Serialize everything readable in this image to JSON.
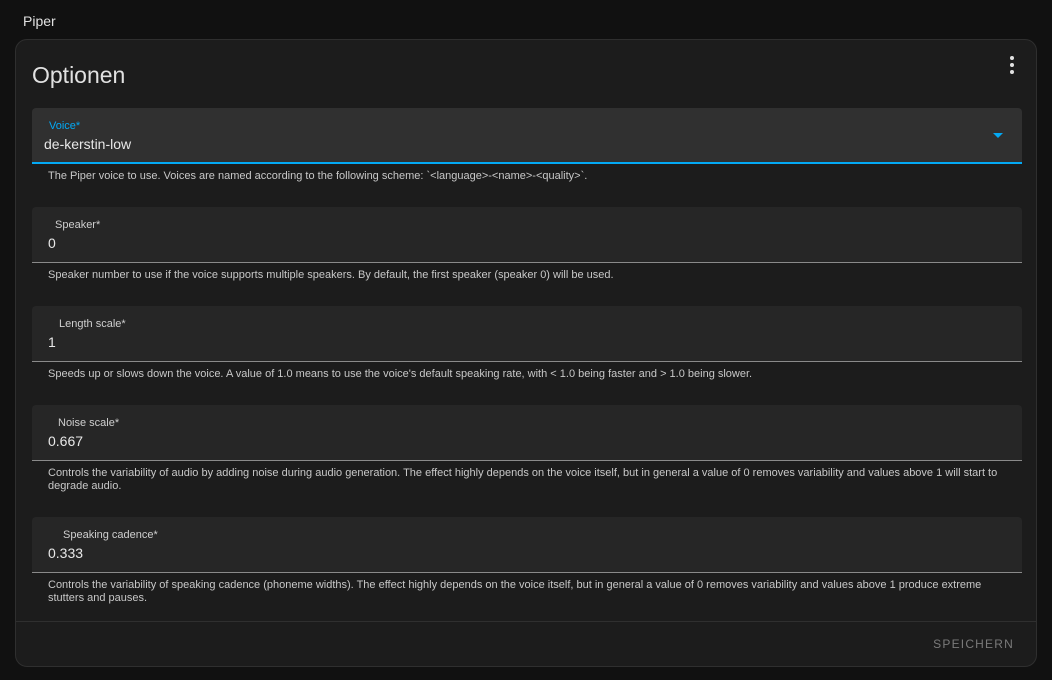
{
  "page": {
    "header": "Piper"
  },
  "card": {
    "title": "Optionen",
    "save_label": "SPEICHERN"
  },
  "fields": {
    "voice": {
      "label": "Voice*",
      "value": "de-kerstin-low",
      "helper": "The Piper voice to use. Voices are named according to the following scheme: `<language>-<name>-<quality>`."
    },
    "speaker": {
      "label": "Speaker*",
      "value": "0",
      "helper": "Speaker number to use if the voice supports multiple speakers. By default, the first speaker (speaker 0) will be used."
    },
    "length_scale": {
      "label": "Length scale*",
      "value": "1",
      "helper": "Speeds up or slows down the voice. A value of 1.0 means to use the voice's default speaking rate, with < 1.0 being faster and > 1.0 being slower."
    },
    "noise_scale": {
      "label": "Noise scale*",
      "value": "0.667",
      "helper": "Controls the variability of audio by adding noise during audio generation. The effect highly depends on the voice itself, but in general a value of 0 removes variability and values above 1 will start to degrade audio."
    },
    "speaking_cadence": {
      "label": "Speaking cadence*",
      "value": "0.333",
      "helper": "Controls the variability of speaking cadence (phoneme widths). The effect highly depends on the voice itself, but in general a value of 0 removes variability and values above 1 produce extreme stutters and pauses."
    }
  },
  "colors": {
    "accent": "#03a9f4",
    "background": "#111111",
    "card": "#1c1c1c"
  }
}
